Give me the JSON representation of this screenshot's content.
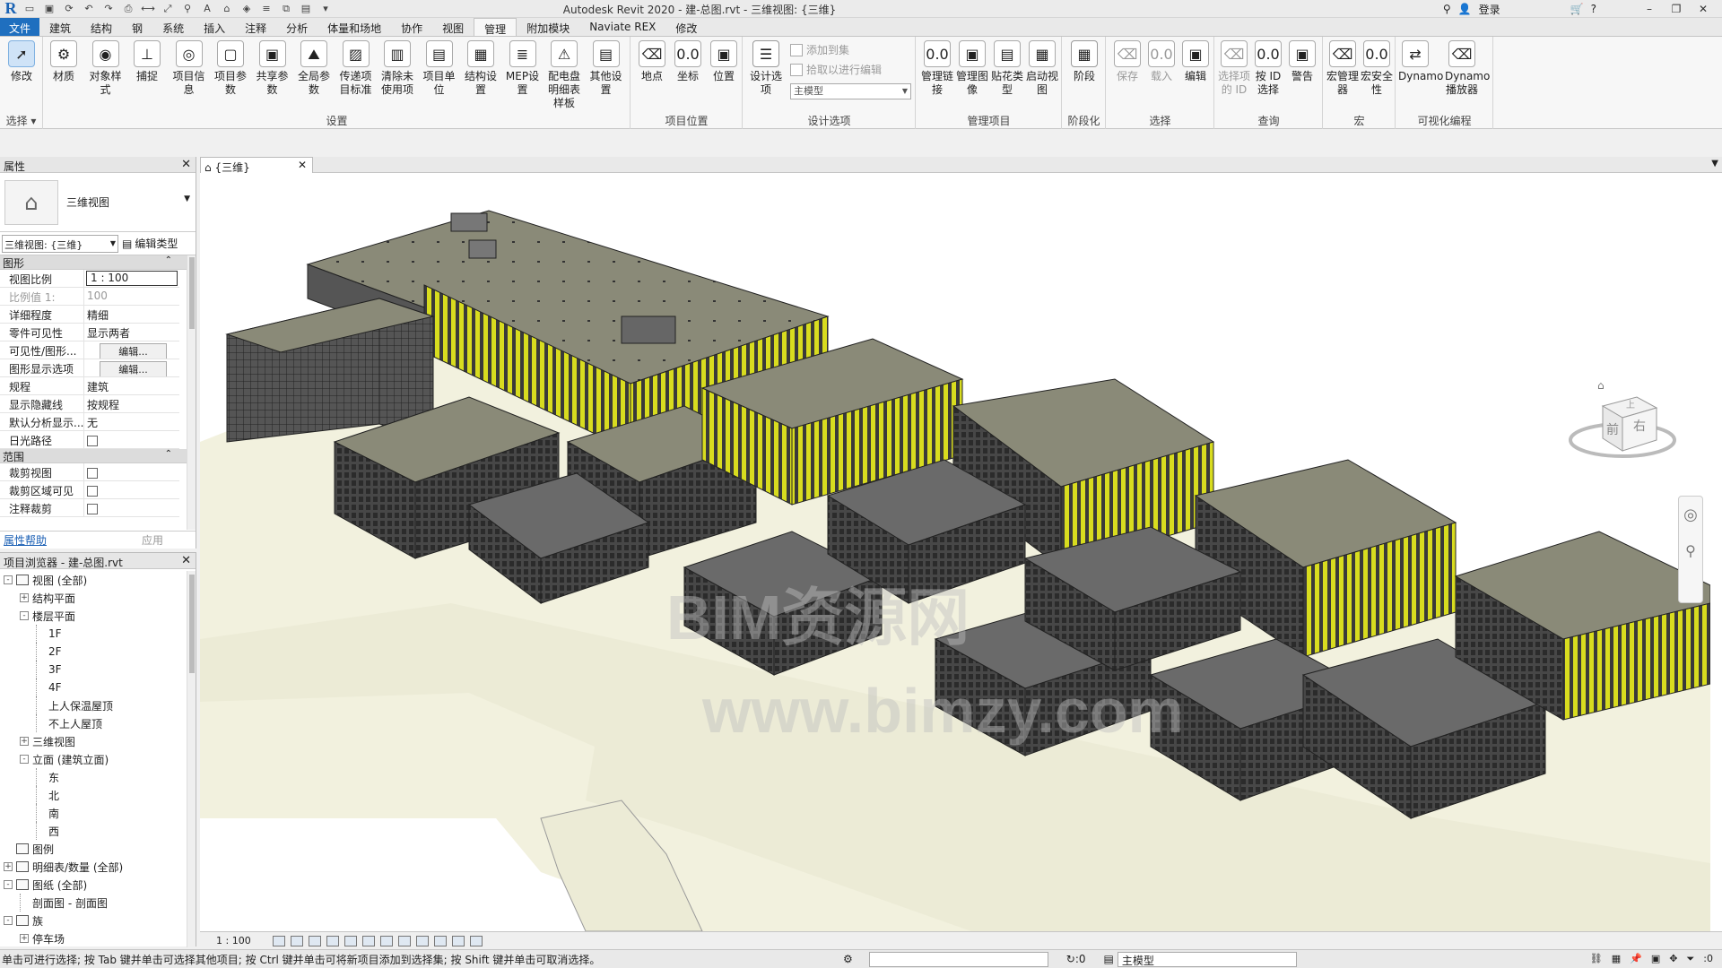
{
  "titlebar": {
    "app_logo": "R",
    "title": "Autodesk Revit 2020 - 建-总图.rvt - 三维视图: {三维}",
    "login_label": "登录",
    "quick_access_icons": [
      "open-icon",
      "save-icon",
      "sync-icon",
      "undo-icon",
      "redo-icon",
      "print-icon",
      "measure-icon",
      "dimension-icon",
      "tag-icon",
      "text-icon",
      "3d-view-icon",
      "section-icon",
      "thin-lines-icon",
      "close-hidden-icon",
      "switch-windows-icon",
      "customize-icon"
    ]
  },
  "tabs": [
    "文件",
    "建筑",
    "结构",
    "钢",
    "系统",
    "插入",
    "注释",
    "分析",
    "体量和场地",
    "协作",
    "视图",
    "管理",
    "附加模块",
    "Naviate REX",
    "修改"
  ],
  "active_tab": "管理",
  "ribbon": {
    "select": {
      "label": "选择",
      "buttons": [
        "修改"
      ]
    },
    "settings": {
      "label": "设置",
      "buttons": [
        "材质",
        "对象样式",
        "捕捉",
        "项目信息",
        "项目参数",
        "共享参数",
        "全局参数",
        "传递项目标准",
        "清除未使用项",
        "项目单位",
        "结构设置",
        "MEP设置",
        "配电盘明细表样板",
        "其他设置"
      ]
    },
    "project_location": {
      "label": "项目位置",
      "buttons": [
        "地点",
        "坐标",
        "位置"
      ]
    },
    "design_options": {
      "label": "设计选项",
      "buttons": [
        "设计选项"
      ],
      "add_to_set": "添加到集",
      "pick_to_edit": "拾取以进行编辑",
      "main_model": "主模型"
    },
    "manage_project": {
      "label": "管理项目",
      "buttons": [
        "管理链接",
        "管理图像",
        "贴花类型",
        "启动视图"
      ]
    },
    "phasing": {
      "label": "阶段化",
      "buttons": [
        "阶段"
      ]
    },
    "selection": {
      "label": "选择",
      "buttons": [
        "保存",
        "载入",
        "编辑"
      ]
    },
    "inquiry": {
      "label": "查询",
      "buttons": [
        "选择项的 ID",
        "按 ID 选择",
        "警告"
      ]
    },
    "macros": {
      "label": "宏",
      "buttons": [
        "宏管理器",
        "宏安全性"
      ]
    },
    "visual_programming": {
      "label": "可视化编程",
      "buttons": [
        "Dynamo",
        "Dynamo播放器"
      ]
    }
  },
  "properties": {
    "title": "属性",
    "type_name": "三维视图",
    "view_selector": "三维视图: {三维}",
    "edit_type": "编辑类型",
    "sections": [
      {
        "name": "图形",
        "rows": [
          {
            "name": "视图比例",
            "value": "1 : 100",
            "kind": "boxed"
          },
          {
            "name": "比例值 1:",
            "value": "100",
            "kind": "muted"
          },
          {
            "name": "详细程度",
            "value": "精细"
          },
          {
            "name": "零件可见性",
            "value": "显示两者"
          },
          {
            "name": "可见性/图形...",
            "value": "编辑...",
            "kind": "btn"
          },
          {
            "name": "图形显示选项",
            "value": "编辑...",
            "kind": "btn"
          },
          {
            "name": "规程",
            "value": "建筑"
          },
          {
            "name": "显示隐藏线",
            "value": "按规程"
          },
          {
            "name": "默认分析显示...",
            "value": "无"
          },
          {
            "name": "日光路径",
            "value": "",
            "kind": "check"
          }
        ]
      },
      {
        "name": "范围",
        "rows": [
          {
            "name": "裁剪视图",
            "value": "",
            "kind": "check"
          },
          {
            "name": "裁剪区域可见",
            "value": "",
            "kind": "check"
          },
          {
            "name": "注释裁剪",
            "value": "",
            "kind": "check"
          }
        ]
      }
    ],
    "help_link": "属性帮助",
    "apply": "应用"
  },
  "browser": {
    "title": "项目浏览器 - 建-总图.rvt",
    "items": [
      {
        "label": "视图 (全部)",
        "level": 0,
        "toggle": "-",
        "icon": true
      },
      {
        "label": "结构平面",
        "level": 1,
        "toggle": "+"
      },
      {
        "label": "楼层平面",
        "level": 1,
        "toggle": "-"
      },
      {
        "label": "1F",
        "level": 2
      },
      {
        "label": "2F",
        "level": 2
      },
      {
        "label": "3F",
        "level": 2
      },
      {
        "label": "4F",
        "level": 2
      },
      {
        "label": "上人保温屋顶",
        "level": 2
      },
      {
        "label": "不上人屋顶",
        "level": 2
      },
      {
        "label": "三维视图",
        "level": 1,
        "toggle": "+"
      },
      {
        "label": "立面 (建筑立面)",
        "level": 1,
        "toggle": "-"
      },
      {
        "label": "东",
        "level": 2
      },
      {
        "label": "北",
        "level": 2
      },
      {
        "label": "南",
        "level": 2
      },
      {
        "label": "西",
        "level": 2
      },
      {
        "label": "图例",
        "level": 0,
        "toggle": "",
        "icon": true
      },
      {
        "label": "明细表/数量 (全部)",
        "level": 0,
        "toggle": "+",
        "icon": true
      },
      {
        "label": "图纸 (全部)",
        "level": 0,
        "toggle": "-",
        "icon": true
      },
      {
        "label": "剖面图 - 剖面图",
        "level": 1
      },
      {
        "label": "族",
        "level": 0,
        "toggle": "-",
        "icon": true
      },
      {
        "label": "停车场",
        "level": 1,
        "toggle": "+"
      }
    ]
  },
  "view": {
    "tab_label": "{三维}",
    "scale": "1 : 100",
    "viewcube_front": "前",
    "viewcube_right": "右",
    "viewcube_top": "上",
    "watermark_line1": "BIM资源网",
    "watermark_line2": "www.bimzy.com"
  },
  "status": {
    "text": "单击可进行选择; 按 Tab 键并单击可选择其他项目; 按 Ctrl 键并单击可将新项目添加到选择集; 按 Shift 键并单击可取消选择。",
    "main_model": "主模型",
    "counter": ":0",
    "filter_count": ":0"
  },
  "colors": {
    "roof": "#8a8a78",
    "facade_dark": "#3d3d3d",
    "accent_yellow": "#d8dc1f",
    "ground": "#f2f1de",
    "file_tab": "#1f6fbf"
  }
}
